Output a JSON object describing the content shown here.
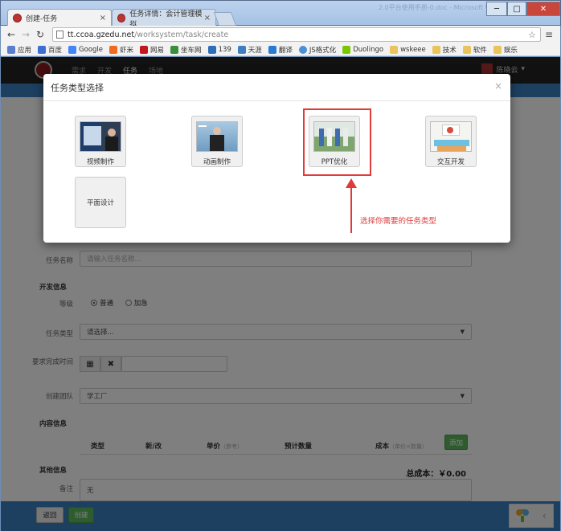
{
  "browser": {
    "tabs": [
      {
        "title": "创建-任务"
      },
      {
        "title": "任务详情：会计管理模拟"
      }
    ],
    "window_ghost_title": "2.0平台使用手册-0.doc - Microsoft Word",
    "url_host": "tt.ccoa.gzedu.net",
    "url_path": "/worksystem/task/create",
    "bookmarks": [
      {
        "label": "应用",
        "color": "#5a7fd1"
      },
      {
        "label": "百度",
        "color": "#3b6fd6"
      },
      {
        "label": "Google",
        "color": "#4285f4"
      },
      {
        "label": "虾米",
        "color": "#f06b1e"
      },
      {
        "label": "网易",
        "color": "#c2171d"
      },
      {
        "label": "坐车网",
        "color": "#3a8f3a"
      },
      {
        "label": "139",
        "color": "#2c6fb8"
      },
      {
        "label": "天涯",
        "color": "#3f7fbf"
      },
      {
        "label": "翻译",
        "color": "#2a79d4"
      },
      {
        "label": "JS格式化",
        "color": "#4a90d9"
      },
      {
        "label": "Duolingo",
        "color": "#78c800"
      },
      {
        "label": "wskeee",
        "color": "#e9c45a"
      },
      {
        "label": "技术",
        "color": "#e9c45a"
      },
      {
        "label": "软件",
        "color": "#e9c45a"
      },
      {
        "label": "娱乐",
        "color": "#e9c45a"
      }
    ]
  },
  "site": {
    "nav": [
      "需求",
      "开发",
      "任务",
      "场地"
    ],
    "user_name": "陈晓云"
  },
  "form": {
    "task_name_label": "任务名称",
    "task_name_placeholder": "请输入任务名称...",
    "dev_info_title": "开发信息",
    "level_label": "等级",
    "level_options": [
      "普通",
      "加急"
    ],
    "task_type_label": "任务类型",
    "task_type_value": "请选择...",
    "deadline_label": "要求完成时间",
    "team_label": "创建团队",
    "team_value": "学工厂",
    "content_title": "内容信息",
    "table_headers": {
      "type": "类型",
      "new_old": "新/改",
      "unit_price": "单价",
      "unit_price_hint": "（参考）",
      "est_qty": "预计数量",
      "cost": "成本",
      "cost_hint": "（单价×数量）"
    },
    "add_button": "添加",
    "other_title": "其他信息",
    "total_cost": "总成本：￥0.00",
    "remark_label": "备注",
    "remark_value": "无"
  },
  "footer": {
    "back_button": "返回",
    "create_button": "创建"
  },
  "modal": {
    "title": "任务类型选择",
    "types": [
      {
        "label": "视频制作"
      },
      {
        "label": "动画制作"
      },
      {
        "label": "PPT优化"
      },
      {
        "label": "交互开发"
      },
      {
        "label": "平面设计"
      }
    ]
  },
  "annotation": "选择你需要的任务类型"
}
